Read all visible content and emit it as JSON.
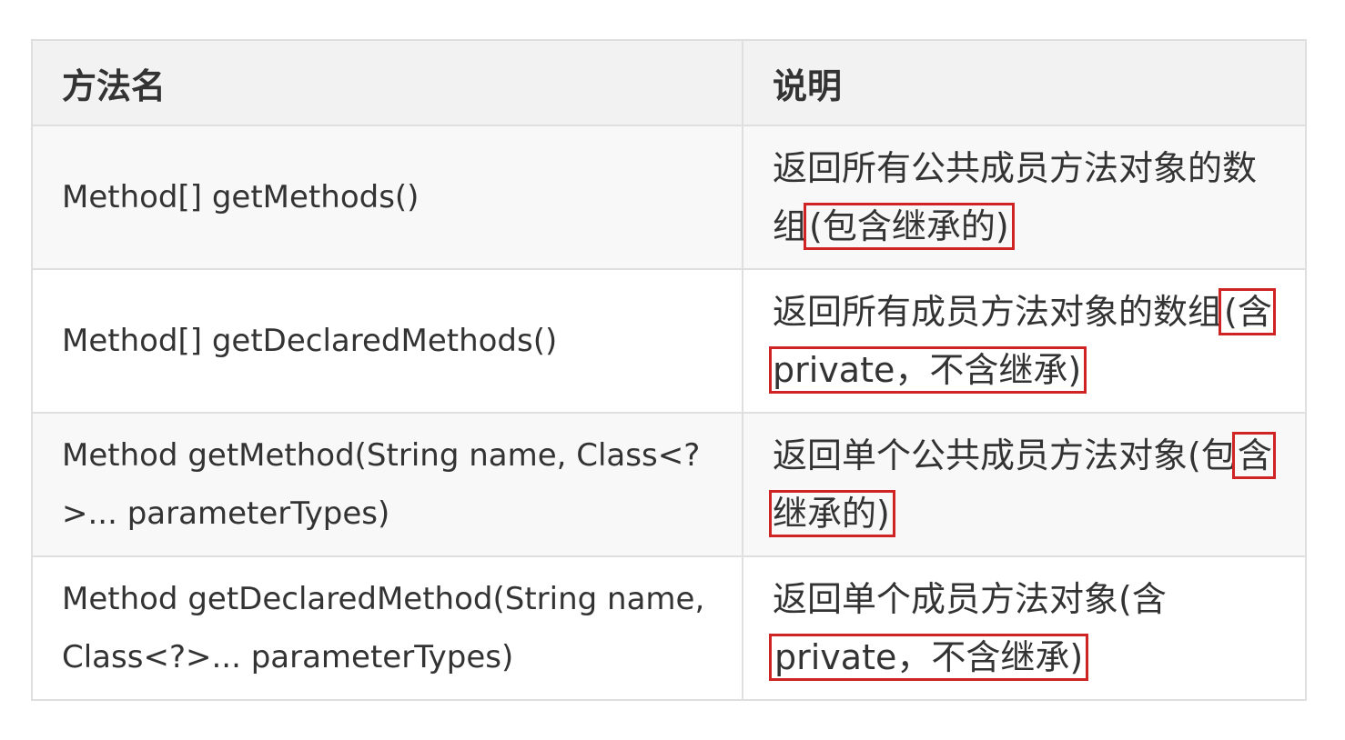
{
  "header": {
    "col1": "方法名",
    "col2": "说明"
  },
  "rows": [
    {
      "method": "Method[] getMethods()",
      "desc_text": "返回所有公共成员方法对象的数组",
      "desc_highlight": "(包含继承的)"
    },
    {
      "method": "Method[] getDeclaredMethods()",
      "desc_text": "返回所有成员方法对象的数组",
      "desc_highlight": "(含private，不含继承)"
    },
    {
      "method": "Method getMethod(String name, Class<?>... parameterTypes)",
      "desc_text": "返回单个公共成员方法对象(包",
      "desc_highlight": "含继承的)"
    },
    {
      "method": "Method getDeclaredMethod(String name, Class<?>... parameterTypes)",
      "desc_text": "返回单个成员方法对象(含",
      "desc_highlight": "private，不含继承)"
    }
  ],
  "colors": {
    "highlight_border": "#d02424",
    "header_bg": "#f2f2f2",
    "border": "#dfdfdf"
  }
}
